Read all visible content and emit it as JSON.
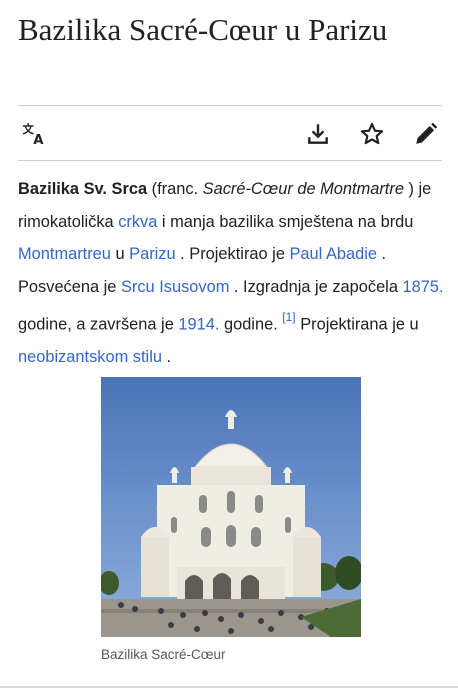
{
  "page": {
    "title": "Bazilika Sacré-Cœur u Parizu"
  },
  "toolbar": {
    "language_icon": "translate-icon",
    "download_icon": "download-icon",
    "watch_icon": "star-icon",
    "edit_icon": "pencil-icon"
  },
  "article": {
    "bold_name": "Bazilika Sv. Srca",
    "t1": " (franc. ",
    "italic_name": "Sacré-Cœur de Montmartre",
    "t2": " ) je rimokatolička ",
    "link_crkva": "crkva",
    "t3": " i manja bazilika smještena na brdu ",
    "link_montmartre": "Montmartreu",
    "t4": " u ",
    "link_parizu": "Parizu",
    "t5": " . Projektirao je ",
    "link_abadie": "Paul Abadie",
    "t6": " . Posvećena je ",
    "link_srcu": "Srcu Isusovom",
    "t7": " . Izgradnja je započela ",
    "link_1875": "1875.",
    "t8": " godine, a završena je ",
    "link_1914": "1914.",
    "t9": " godine. ",
    "ref": "[1]",
    "t10": " Projektirana je u ",
    "link_style": "neobizantskom stilu",
    "t11": " ."
  },
  "figure": {
    "caption": "Bazilika Sacré-Cœur"
  },
  "colors": {
    "link": "#3366cc",
    "text": "#202122",
    "icon": "#202122",
    "caption": "#54595d",
    "sky": "#5b83c4",
    "stone": "#efece4"
  }
}
